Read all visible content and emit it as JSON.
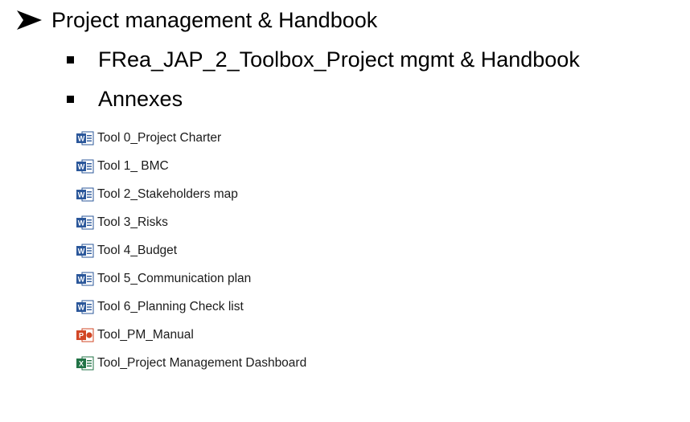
{
  "outline": {
    "heading": "Project management & Handbook",
    "subitems": [
      "FRea_JAP_2_Toolbox_Project mgmt & Handbook",
      "Annexes"
    ]
  },
  "files": [
    {
      "name": "Tool 0_Project Charter",
      "icon": "word-document-icon"
    },
    {
      "name": "Tool 1_ BMC",
      "icon": "word-document-icon"
    },
    {
      "name": "Tool 2_Stakeholders map",
      "icon": "word-document-icon"
    },
    {
      "name": "Tool 3_Risks",
      "icon": "word-document-icon"
    },
    {
      "name": "Tool 4_Budget",
      "icon": "word-document-icon"
    },
    {
      "name": "Tool 5_Communication plan",
      "icon": "word-document-icon"
    },
    {
      "name": "Tool 6_Planning Check list",
      "icon": "word-document-icon"
    },
    {
      "name": "Tool_PM_Manual",
      "icon": "powerpoint-document-icon"
    },
    {
      "name": "Tool_Project Management Dashboard",
      "icon": "excel-document-icon"
    }
  ],
  "colors": {
    "word": "#2b579a",
    "powerpoint": "#d24726",
    "excel": "#217346"
  }
}
